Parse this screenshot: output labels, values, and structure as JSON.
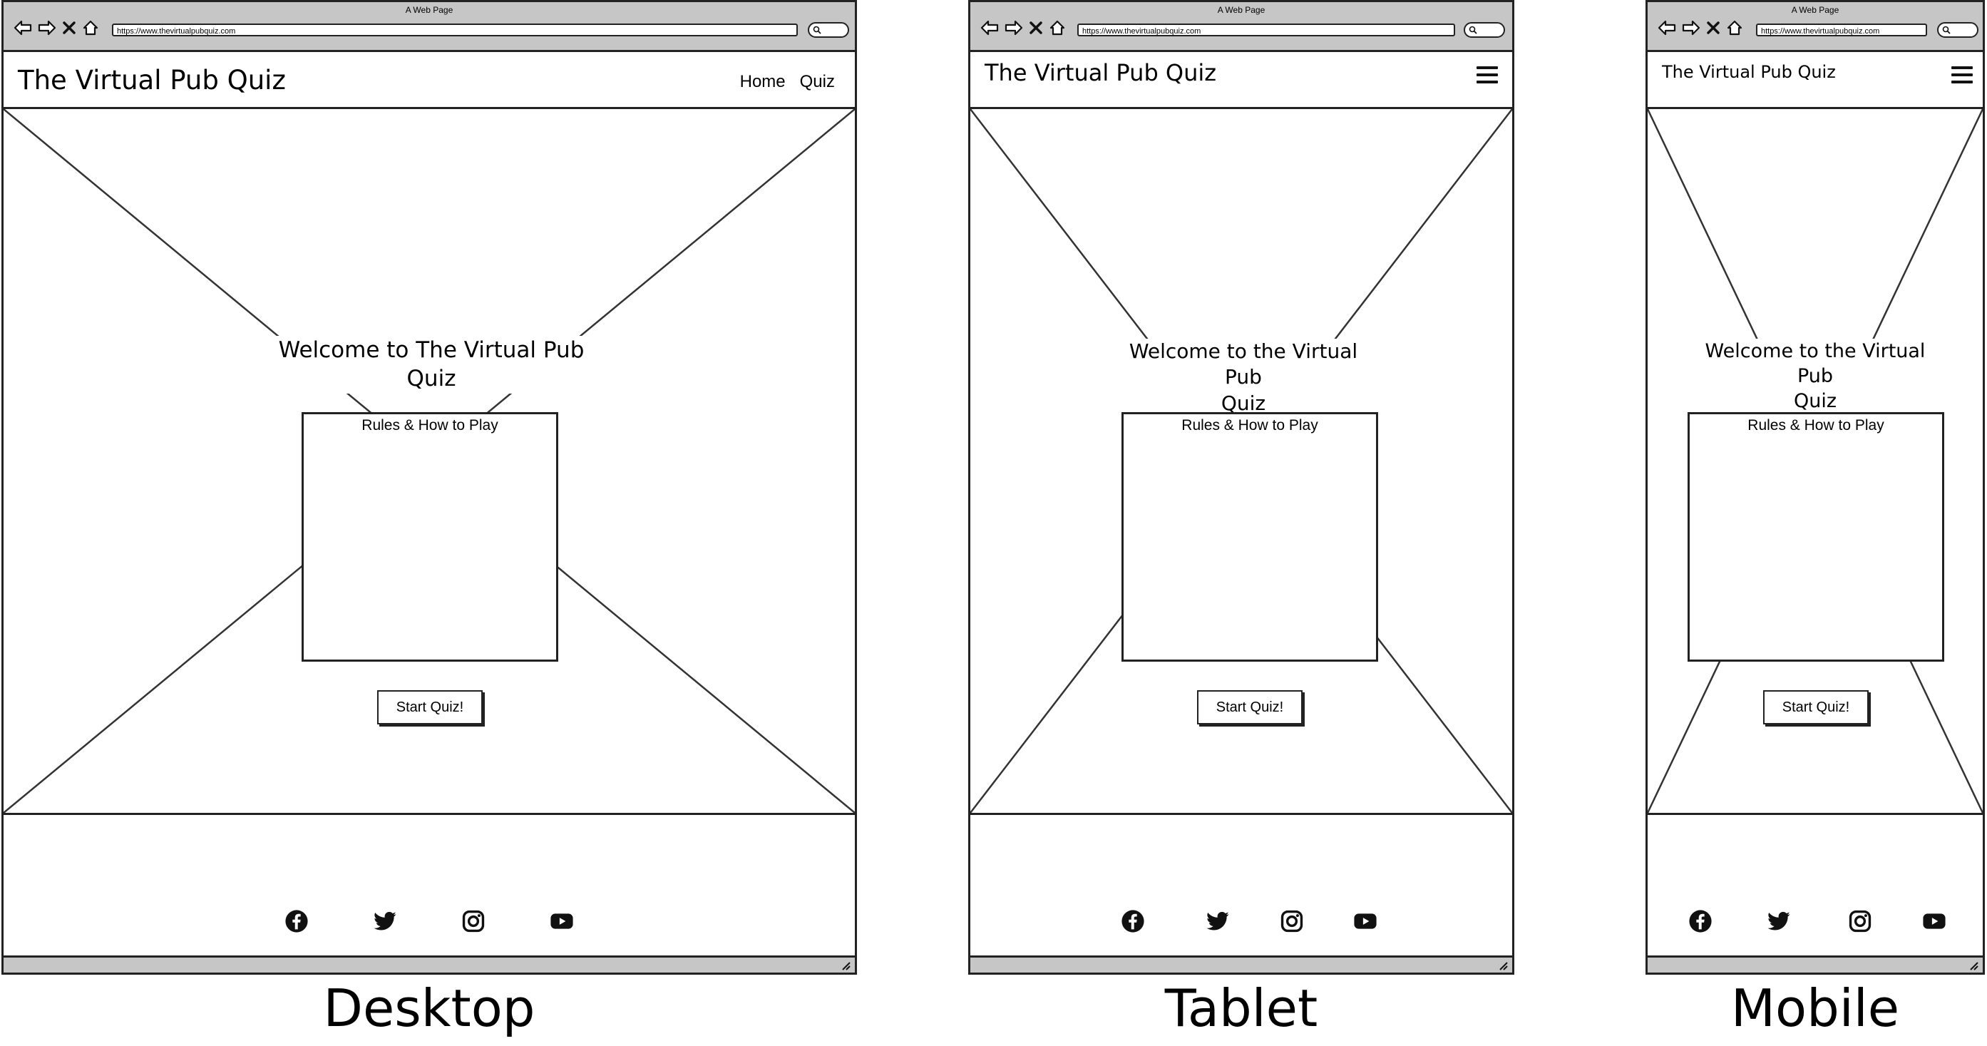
{
  "mockups": {
    "desktop": {
      "window_title": "A Web Page",
      "url": "https://www.thevirtualpubquiz.com",
      "site_title": "The Virtual Pub Quiz",
      "nav": {
        "home": "Home",
        "quiz": "Quiz"
      },
      "welcome_line1": "Welcome to The Virtual Pub",
      "welcome_line2": "Quiz",
      "rules_title": "Rules & How to Play",
      "start_button": "Start Quiz!",
      "caption": "Desktop"
    },
    "tablet": {
      "window_title": "A Web Page",
      "url": "https://www.thevirtualpubquiz.com",
      "site_title": "The Virtual Pub Quiz",
      "welcome_line1": "Welcome to the Virtual Pub",
      "welcome_line2": "Quiz",
      "rules_title": "Rules & How to Play",
      "start_button": "Start Quiz!",
      "caption": "Tablet"
    },
    "mobile": {
      "window_title": "A Web Page",
      "url": "https://www.thevirtualpubquiz.com",
      "site_title": "The Virtual Pub Quiz",
      "welcome_line1": "Welcome to the Virtual Pub",
      "welcome_line2": "Quiz",
      "rules_title": "Rules & How to Play",
      "start_button": "Start Quiz!",
      "caption": "Mobile"
    }
  },
  "social_icons": [
    "facebook-icon",
    "twitter-icon",
    "instagram-icon",
    "youtube-icon"
  ],
  "colors": {
    "chrome": "#c6c6c6",
    "stroke": "#222222",
    "background": "#ffffff"
  }
}
